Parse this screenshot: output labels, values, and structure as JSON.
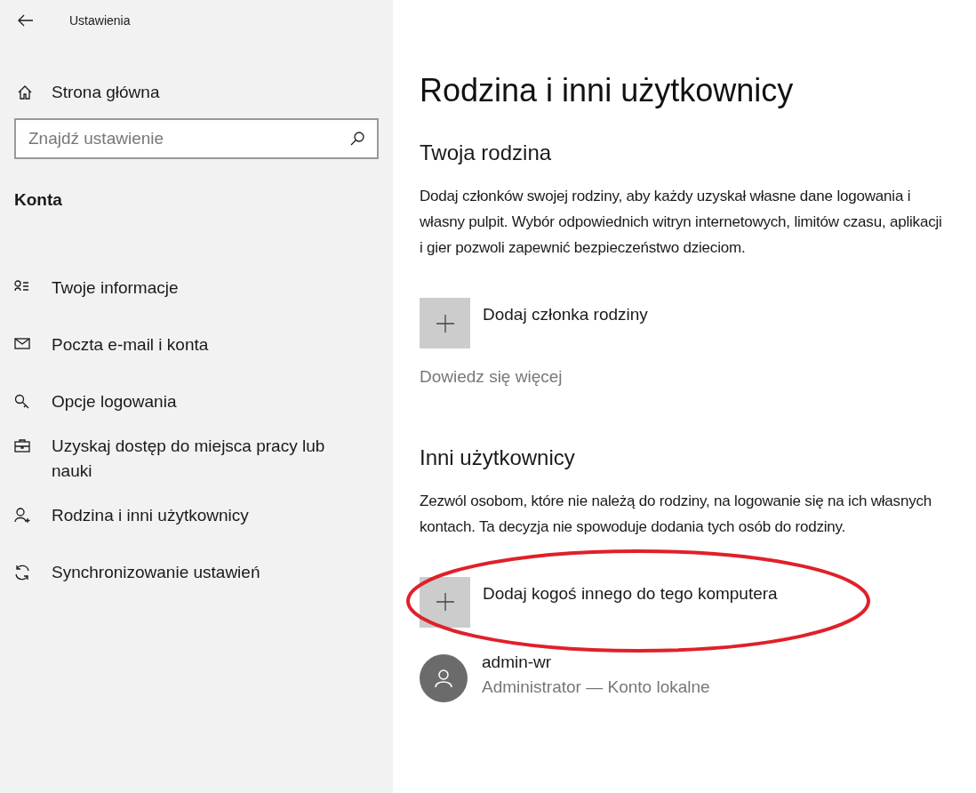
{
  "window": {
    "title": "Ustawienia"
  },
  "sidebar": {
    "home": "Strona główna",
    "search": {
      "placeholder": "Znajdź ustawienie"
    },
    "section": "Konta",
    "items": [
      {
        "label": "Twoje informacje"
      },
      {
        "label": "Poczta e-mail i konta"
      },
      {
        "label": "Opcje logowania"
      },
      {
        "label": "Uzyskaj dostęp do miejsca pracy lub nauki"
      },
      {
        "label": "Rodzina i inni użytkownicy"
      },
      {
        "label": "Synchronizowanie ustawień"
      }
    ]
  },
  "main": {
    "title": "Rodzina i inni użytkownicy",
    "family": {
      "heading": "Twoja rodzina",
      "text": "Dodaj członków swojej rodziny, aby każdy uzyskał własne dane logowania i własny pulpit. Wybór odpowiednich witryn internetowych, limitów czasu, aplikacji i gier pozwoli zapewnić bezpieczeństwo dzieciom.",
      "add": "Dodaj członka rodziny",
      "link": "Dowiedz się więcej"
    },
    "others": {
      "heading": "Inni użytkownicy",
      "text": "Zezwól osobom, które nie należą do rodziny, na logowanie się na ich własnych kontach. Ta decyzja nie spowoduje dodania tych osób do rodziny.",
      "add": "Dodaj kogoś innego do tego komputera",
      "highlighted": true,
      "users": [
        {
          "name": "admin-wr",
          "detail": "Administrator — Konto lokalne"
        }
      ]
    }
  }
}
